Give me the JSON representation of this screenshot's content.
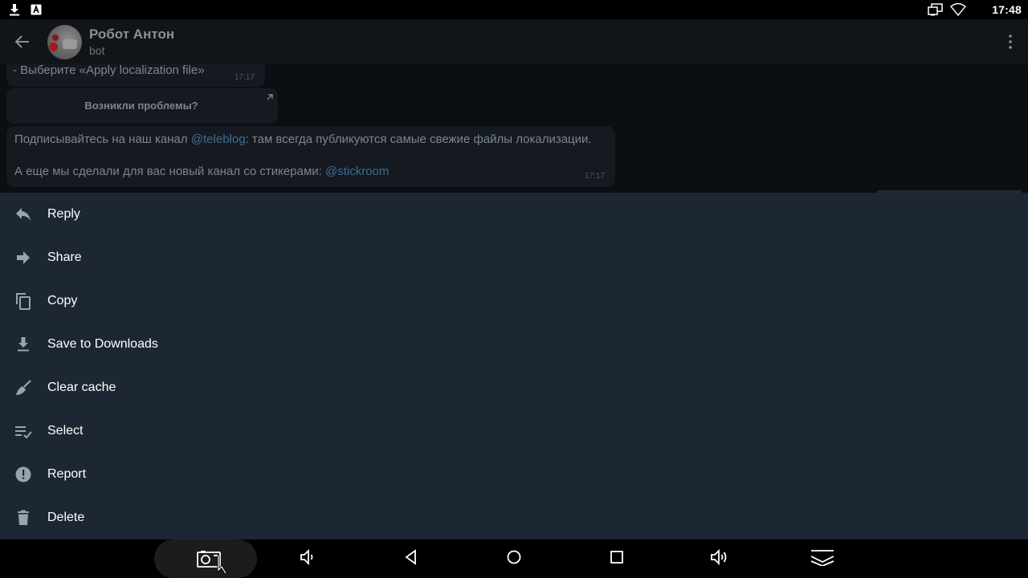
{
  "status_bar": {
    "time": "17:48",
    "left_icons": [
      "download-icon",
      "text-notification-icon"
    ],
    "right_icons": [
      "cast-screen-icon",
      "wifi-icon"
    ]
  },
  "chat": {
    "title": "Робот Антон",
    "subtitle": "bot",
    "messages": [
      {
        "text": "- Выберите «Apply localization file»",
        "time": "17:17"
      },
      {
        "line1_before": "Подписывайтесь на наш канал ",
        "line1_link": "@teleblog",
        "line1_after": ": там всегда публикуются самые свежие файлы локализации.",
        "line2_before": "А еще мы сделали для вас новый канал со стикерами: ",
        "line2_link": "@stickroom",
        "time": "17:17"
      }
    ],
    "inline_button": "Возникли проблемы?"
  },
  "menu": {
    "items": [
      {
        "label": "Reply",
        "icon": "reply-icon"
      },
      {
        "label": "Share",
        "icon": "share-icon"
      },
      {
        "label": "Copy",
        "icon": "copy-icon"
      },
      {
        "label": "Save to Downloads",
        "icon": "download-icon"
      },
      {
        "label": "Clear cache",
        "icon": "broom-icon"
      },
      {
        "label": "Select",
        "icon": "select-icon"
      },
      {
        "label": "Report",
        "icon": "report-icon"
      },
      {
        "label": "Delete",
        "icon": "trash-icon"
      }
    ]
  },
  "nav_bar": {
    "buttons": [
      "screenshot-icon",
      "volume-down-icon",
      "back-icon",
      "home-icon",
      "recents-icon",
      "volume-up-icon",
      "hide-navbar-icon"
    ]
  },
  "colors": {
    "menu_background": "#1d2733",
    "chat_background": "#0b0e12",
    "link": "#3f6d93"
  }
}
